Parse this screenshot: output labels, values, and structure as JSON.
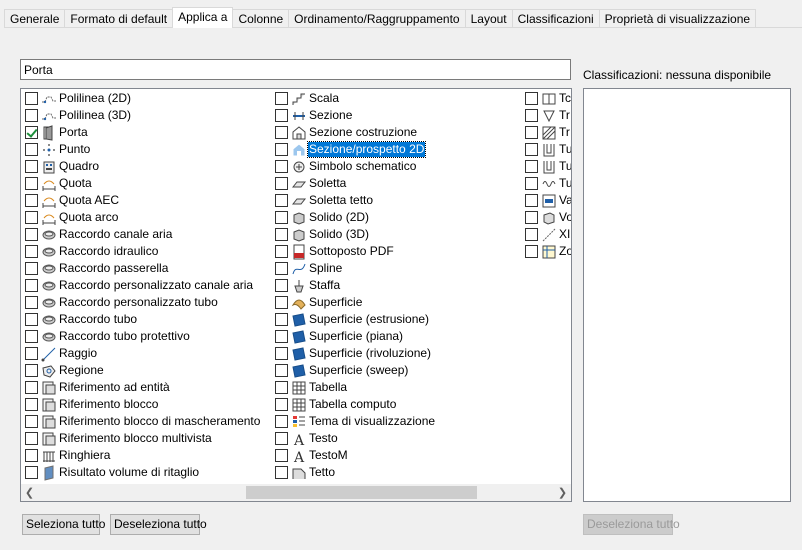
{
  "tabs": [
    {
      "label": "Generale"
    },
    {
      "label": "Formato di default"
    },
    {
      "label": "Applica a",
      "active": true
    },
    {
      "label": "Colonne"
    },
    {
      "label": "Ordinamento/Raggruppamento"
    },
    {
      "label": "Layout"
    },
    {
      "label": "Classificazioni"
    },
    {
      "label": "Proprietà di visualizzazione"
    }
  ],
  "name_input": {
    "value": "Porta"
  },
  "objects": {
    "columns": [
      [
        {
          "label": "Polilinea (2D)",
          "icon": "polyline-2d-icon"
        },
        {
          "label": "Polilinea (3D)",
          "icon": "polyline-3d-icon"
        },
        {
          "label": "Porta",
          "icon": "door-icon",
          "checked": true
        },
        {
          "label": "Punto",
          "icon": "point-icon"
        },
        {
          "label": "Quadro",
          "icon": "panel-icon"
        },
        {
          "label": "Quota",
          "icon": "dimension-icon"
        },
        {
          "label": "Quota AEC",
          "icon": "aec-dimension-icon"
        },
        {
          "label": "Quota arco",
          "icon": "arc-dimension-icon"
        },
        {
          "label": "Raccordo canale aria",
          "icon": "duct-fitting-icon"
        },
        {
          "label": "Raccordo idraulico",
          "icon": "plumbing-fitting-icon"
        },
        {
          "label": "Raccordo passerella",
          "icon": "cable-tray-fitting-icon"
        },
        {
          "label": "Raccordo personalizzato canale aria",
          "icon": "custom-duct-fitting-icon"
        },
        {
          "label": "Raccordo personalizzato tubo",
          "icon": "custom-pipe-fitting-icon"
        },
        {
          "label": "Raccordo tubo",
          "icon": "pipe-fitting-icon"
        },
        {
          "label": "Raccordo tubo protettivo",
          "icon": "conduit-fitting-icon"
        },
        {
          "label": "Raggio",
          "icon": "ray-icon"
        },
        {
          "label": "Regione",
          "icon": "region-icon"
        },
        {
          "label": "Riferimento ad entità",
          "icon": "entity-reference-icon"
        },
        {
          "label": "Riferimento blocco",
          "icon": "block-reference-icon"
        },
        {
          "label": "Riferimento blocco di mascheramento",
          "icon": "mask-block-reference-icon"
        },
        {
          "label": "Riferimento blocco multivista",
          "icon": "multiview-block-reference-icon"
        },
        {
          "label": "Ringhiera",
          "icon": "railing-icon"
        },
        {
          "label": "Risultato volume di ritaglio",
          "icon": "clip-volume-result-icon"
        }
      ],
      [
        {
          "label": "Scala",
          "icon": "stair-icon"
        },
        {
          "label": "Sezione",
          "icon": "section-icon"
        },
        {
          "label": "Sezione costruzione",
          "icon": "building-section-icon"
        },
        {
          "label": "Sezione/prospetto 2D",
          "icon": "section-elevation-2d-icon",
          "selected": true
        },
        {
          "label": "Simbolo schematico",
          "icon": "schematic-symbol-icon"
        },
        {
          "label": "Soletta",
          "icon": "slab-icon"
        },
        {
          "label": "Soletta tetto",
          "icon": "roof-slab-icon"
        },
        {
          "label": "Solido (2D)",
          "icon": "solid-2d-icon"
        },
        {
          "label": "Solido (3D)",
          "icon": "solid-3d-icon"
        },
        {
          "label": "Sottoposto PDF",
          "icon": "pdf-underlay-icon"
        },
        {
          "label": "Spline",
          "icon": "spline-icon"
        },
        {
          "label": "Staffa",
          "icon": "hanger-icon"
        },
        {
          "label": "Superficie",
          "icon": "surface-icon"
        },
        {
          "label": "Superficie (estrusione)",
          "icon": "extruded-surface-icon"
        },
        {
          "label": "Superficie (piana)",
          "icon": "planar-surface-icon"
        },
        {
          "label": "Superficie (rivoluzione)",
          "icon": "revolved-surface-icon"
        },
        {
          "label": "Superficie (sweep)",
          "icon": "swept-surface-icon"
        },
        {
          "label": "Tabella",
          "icon": "table-icon"
        },
        {
          "label": "Tabella computo",
          "icon": "schedule-table-icon"
        },
        {
          "label": "Tema di visualizzazione",
          "icon": "display-theme-icon"
        },
        {
          "label": "Testo",
          "icon": "text-icon"
        },
        {
          "label": "TestoM",
          "icon": "mtext-icon"
        },
        {
          "label": "Tetto",
          "icon": "roof-icon"
        }
      ],
      [
        {
          "label": "Tc",
          "icon": "tc-icon"
        },
        {
          "label": "Tr",
          "icon": "tr-icon"
        },
        {
          "label": "Tr",
          "icon": "tr-hatch-icon"
        },
        {
          "label": "Tu",
          "icon": "tu-icon"
        },
        {
          "label": "Tu",
          "icon": "tu-bracket-icon"
        },
        {
          "label": "Tu",
          "icon": "tu-coil-icon"
        },
        {
          "label": "Va",
          "icon": "va-icon"
        },
        {
          "label": "Vo",
          "icon": "vo-icon"
        },
        {
          "label": "XI",
          "icon": "xline-icon"
        },
        {
          "label": "Zo",
          "icon": "zone-icon"
        }
      ]
    ]
  },
  "classifications": {
    "label": "Classificazioni: nessuna disponibile",
    "label_prefix": "Classificazioni",
    "mnemonic": "C"
  },
  "buttons": {
    "select_all": "Seleziona tutto",
    "deselect_all": "Deseleziona tutto",
    "deselect_all_right": "Deseleziona tutto"
  },
  "colors": {
    "accent": "#0078d7",
    "check": "#1b8e3a"
  }
}
